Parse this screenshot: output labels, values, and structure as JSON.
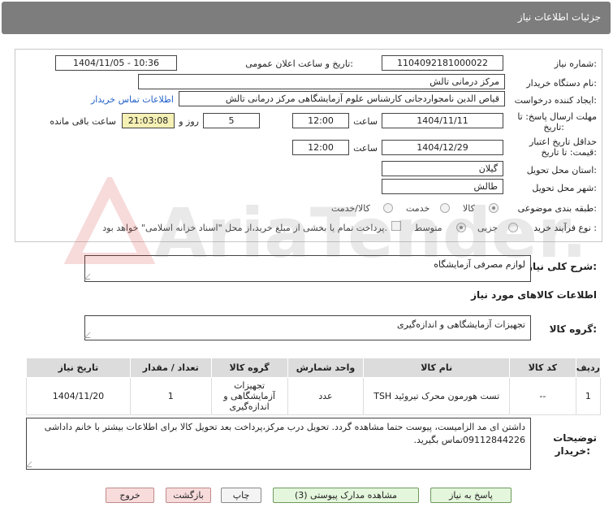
{
  "header": {
    "title": "جزئیات اطلاعات نیاز"
  },
  "form": {
    "need_number_label": "شماره نیاز:",
    "need_number": "1104092181000022",
    "announce_label": "تاریخ و ساعت اعلان عمومی:",
    "announce_value": "1404/11/05 - 10:36",
    "buyer_org_label": "نام دستگاه خریدار:",
    "buyer_org": "مرکز درمانی تالش",
    "requester_label": "ایجاد کننده درخواست:",
    "requester": "قیاص الدین نامجواردجانی کارشناس علوم آزمایشگاهی مرکز درمانی تالش",
    "contact_link": "اطلاعات تماس خریدار",
    "deadline_label_1": "مهلت ارسال پاسخ: تا",
    "deadline_label_2": "تاریخ:",
    "deadline_date": "1404/11/11",
    "time_label": "ساعت",
    "deadline_time": "12:00",
    "days_value": "5",
    "days_label": "روز و",
    "remaining_time": "21:03:08",
    "remaining_label": "ساعت باقی مانده",
    "validity_label_1": "حداقل تاریخ اعتبار",
    "validity_label_2": "قیمت: تا تاریخ:",
    "validity_date": "1404/12/29",
    "validity_time": "12:00",
    "province_label": "استان محل تحویل:",
    "province": "گیلان",
    "city_label": "شهر محل تحویل:",
    "city": "طالش",
    "category_label": "طبقه بندی موضوعی:",
    "category_options": [
      "کالا",
      "خدمت",
      "کالا/خدمت"
    ],
    "process_label": "نوع فرآیند خرید :",
    "process_options": [
      "جزیی",
      "متوسط"
    ],
    "payment_note": "پرداخت تمام یا بخشی از مبلغ خرید،از محل \"اسناد خزانه اسلامی\" خواهد بود."
  },
  "summary": {
    "label": "شرح کلی نیاز:",
    "value": "لوازم مصرفی آزمایشگاه"
  },
  "goods": {
    "section_title": "اطلاعات کالاهای مورد نیاز",
    "group_label": "گروه کالا:",
    "group_value": "تجهیزات آزمایشگاهی و اندازه‌گیری"
  },
  "table": {
    "headers": [
      "ردیف",
      "کد کالا",
      "نام کالا",
      "واحد شمارش",
      "گروه کالا",
      "تعداد / مقدار",
      "تاریخ نیاز"
    ],
    "rows": [
      {
        "row": "1",
        "code": "--",
        "name": "تست هورمون محرک تیروئید TSH",
        "unit": "عدد",
        "group_line1": "تجهیزات",
        "group_line2": "آزمایشگاهی و",
        "group_line3": "اندازه‌گیری",
        "qty": "1",
        "date": "1404/11/20"
      }
    ]
  },
  "buyer_notes": {
    "label_1": "توضیحات",
    "label_2": "خریدار:",
    "text": "داشتن ای مد الزامیست،  پیوست حتما مشاهده گردد. تحویل درب مرکز،پرداخت بعد تحویل کالا برای اطلاعات بیشتر با خانم داداشی 09112844226تماس بگیرید."
  },
  "buttons": {
    "reply": "پاسخ به نیاز",
    "docs": "مشاهده مدارک پیوستی (3)",
    "print": "چاپ",
    "back": "بازگشت",
    "exit": "خروج"
  },
  "watermark": {
    "text": "AriaTender.net"
  }
}
